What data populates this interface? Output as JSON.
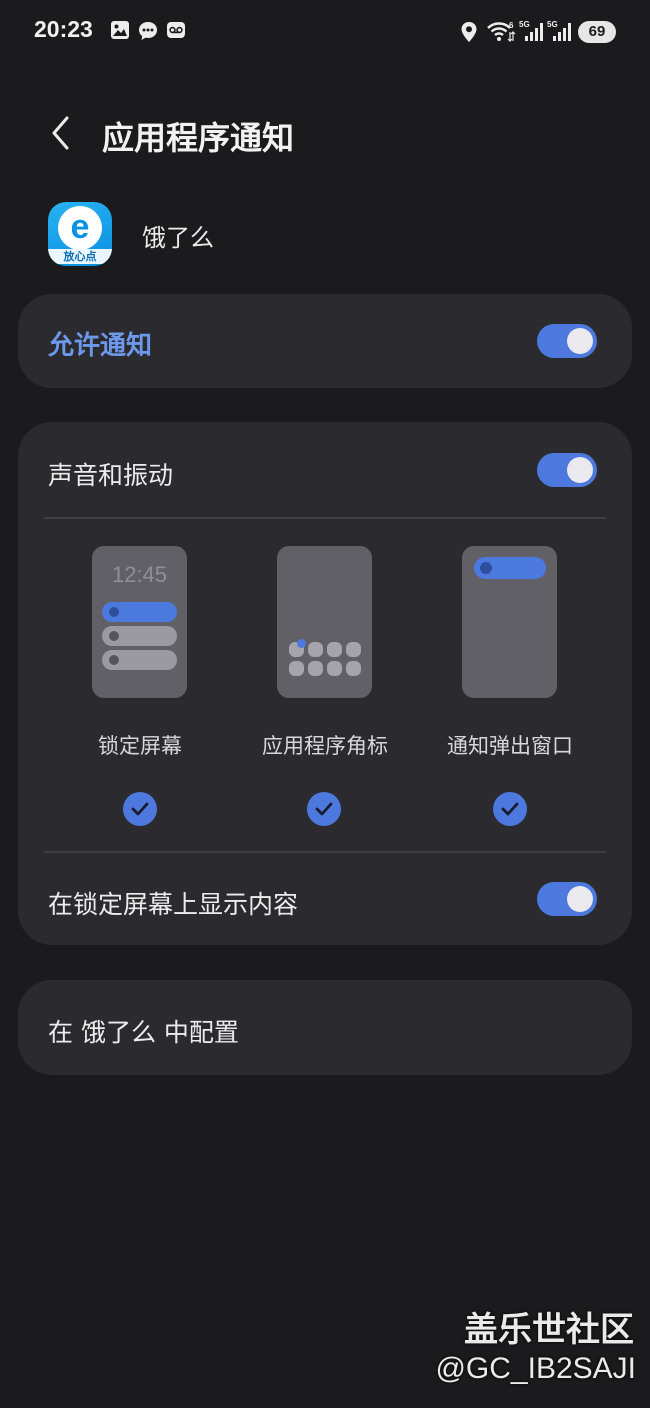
{
  "status_bar": {
    "time": "20:23",
    "battery": "69",
    "icons": [
      "gallery-icon",
      "message-icon",
      "voicemail-icon",
      "location-icon",
      "wifi-icon",
      "signal-5g-icon",
      "signal-5g-icon"
    ],
    "signal_tags": [
      "5G",
      "5G"
    ],
    "wifi_tag": "6"
  },
  "header": {
    "title": "应用程序通知"
  },
  "app": {
    "name": "饿了么",
    "icon": "eleme-app-icon",
    "icon_letter": "e",
    "icon_caption": "放心点"
  },
  "allow_notifications": {
    "label": "允许通知",
    "enabled": true
  },
  "sound_vibration": {
    "label": "声音和振动",
    "enabled": true
  },
  "illustrations": {
    "lock_screen_time": "12:45"
  },
  "notification_types": [
    {
      "label": "锁定屏幕",
      "checked": true
    },
    {
      "label": "应用程序角标",
      "checked": true
    },
    {
      "label": "通知弹出窗口",
      "checked": true
    }
  ],
  "show_content_on_lock": {
    "label": "在锁定屏幕上显示内容",
    "enabled": true
  },
  "configure_in_app": {
    "label": "在 饿了么 中配置"
  },
  "watermark": {
    "title": "盖乐世社区",
    "user": "@GC_IB2SAJI"
  },
  "colors": {
    "accent": "#4d79de",
    "allow_label": "#6d99ec",
    "background": "#1b1b1d",
    "card": "#2b2b2f"
  }
}
